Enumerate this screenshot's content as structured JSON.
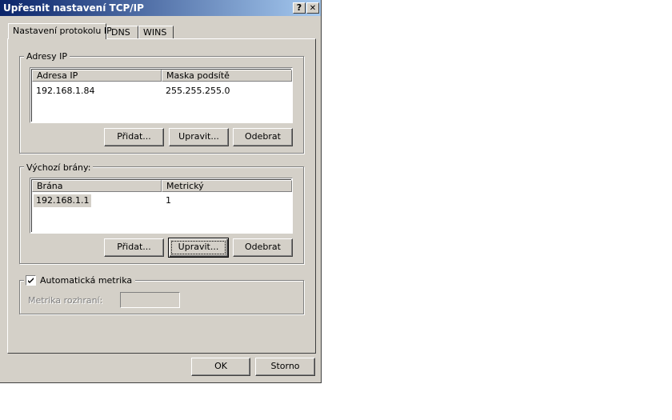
{
  "window": {
    "title": "Upřesnit nastavení TCP/IP",
    "help_label": "?",
    "close_label": "✕"
  },
  "tabs": [
    {
      "label": "Nastavení protokolu IP"
    },
    {
      "label": "DNS"
    },
    {
      "label": "WINS"
    }
  ],
  "ip_group": {
    "legend": "Adresy IP",
    "columns": [
      "Adresa IP",
      "Maska podsítě"
    ],
    "rows": [
      {
        "ip": "192.168.1.84",
        "mask": "255.255.255.0"
      }
    ],
    "add_label": "Přidat...",
    "edit_label": "Upravit...",
    "remove_label": "Odebrat"
  },
  "gateway_group": {
    "legend": "Výchozí brány:",
    "columns": [
      "Brána",
      "Metrický"
    ],
    "rows": [
      {
        "gateway": "192.168.1.1",
        "metric": "1"
      }
    ],
    "add_label": "Přidat...",
    "edit_label": "Upravit...",
    "remove_label": "Odebrat"
  },
  "metric_group": {
    "auto_metric_label": "Automatická metrika",
    "auto_metric_checked": true,
    "interface_metric_label": "Metrika rozhraní:",
    "interface_metric_value": ""
  },
  "footer": {
    "ok_label": "OK",
    "cancel_label": "Storno"
  }
}
